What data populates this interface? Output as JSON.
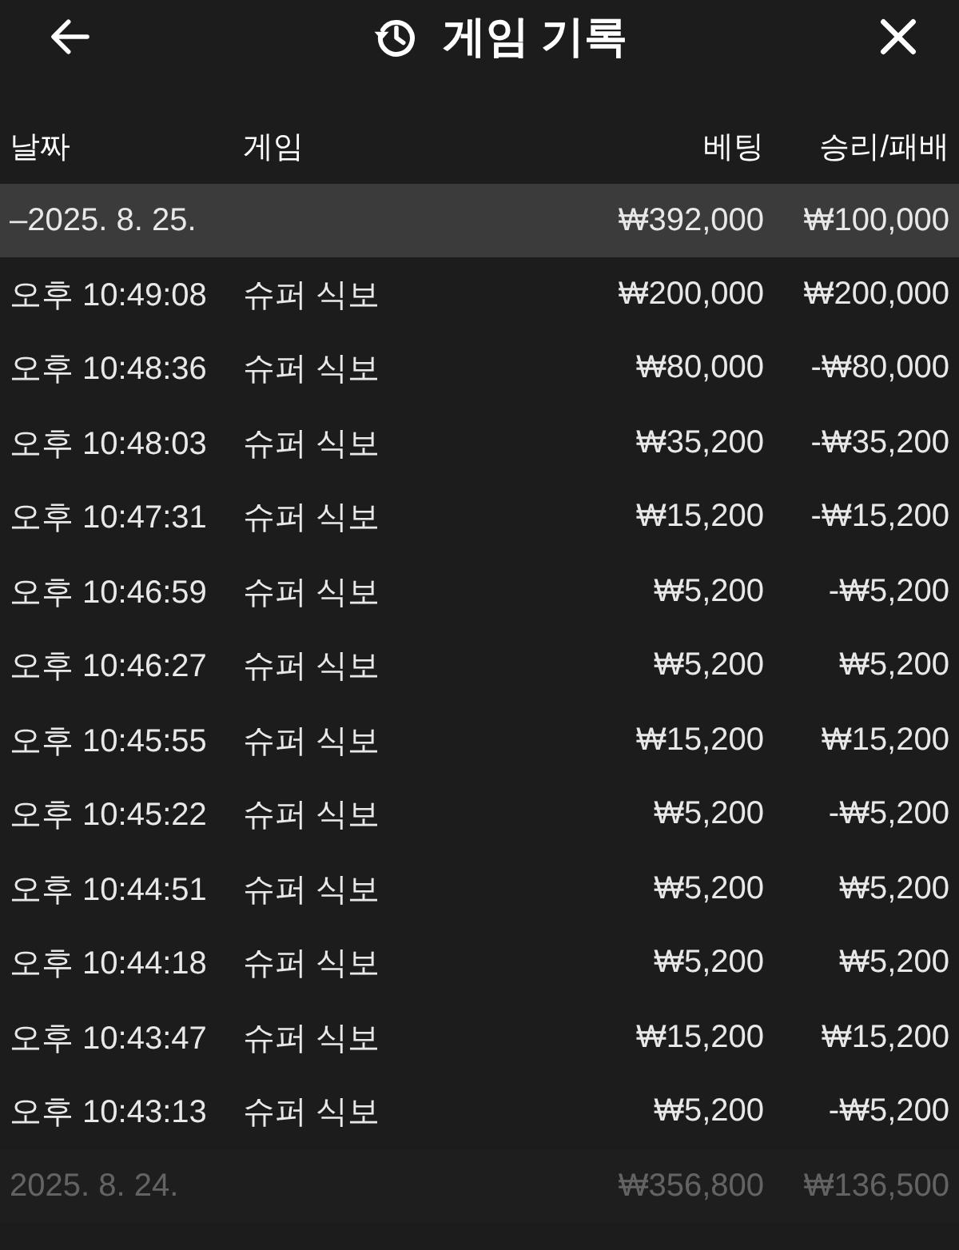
{
  "header": {
    "title": "게임 기록"
  },
  "columns": [
    "날짜",
    "게임",
    "베팅",
    "승리/패배"
  ],
  "groups": [
    {
      "date": "–2025. 8. 25.",
      "bet": "₩392,000",
      "result": "₩100,000",
      "dimmed": false,
      "rows": [
        {
          "time": "오후 10:49:08",
          "game": "슈퍼 식보",
          "bet": "₩200,000",
          "result": "₩200,000"
        },
        {
          "time": "오후 10:48:36",
          "game": "슈퍼 식보",
          "bet": "₩80,000",
          "result": "-₩80,000"
        },
        {
          "time": "오후 10:48:03",
          "game": "슈퍼 식보",
          "bet": "₩35,200",
          "result": "-₩35,200"
        },
        {
          "time": "오후 10:47:31",
          "game": "슈퍼 식보",
          "bet": "₩15,200",
          "result": "-₩15,200"
        },
        {
          "time": "오후 10:46:59",
          "game": "슈퍼 식보",
          "bet": "₩5,200",
          "result": "-₩5,200"
        },
        {
          "time": "오후 10:46:27",
          "game": "슈퍼 식보",
          "bet": "₩5,200",
          "result": "₩5,200"
        },
        {
          "time": "오후 10:45:55",
          "game": "슈퍼 식보",
          "bet": "₩15,200",
          "result": "₩15,200"
        },
        {
          "time": "오후 10:45:22",
          "game": "슈퍼 식보",
          "bet": "₩5,200",
          "result": "-₩5,200"
        },
        {
          "time": "오후 10:44:51",
          "game": "슈퍼 식보",
          "bet": "₩5,200",
          "result": "₩5,200"
        },
        {
          "time": "오후 10:44:18",
          "game": "슈퍼 식보",
          "bet": "₩5,200",
          "result": "₩5,200"
        },
        {
          "time": "오후 10:43:47",
          "game": "슈퍼 식보",
          "bet": "₩15,200",
          "result": "₩15,200"
        },
        {
          "time": "오후 10:43:13",
          "game": "슈퍼 식보",
          "bet": "₩5,200",
          "result": "-₩5,200"
        }
      ]
    },
    {
      "date": "2025. 8. 24.",
      "bet": "₩356,800",
      "result": "₩136,500",
      "dimmed": true
    }
  ]
}
